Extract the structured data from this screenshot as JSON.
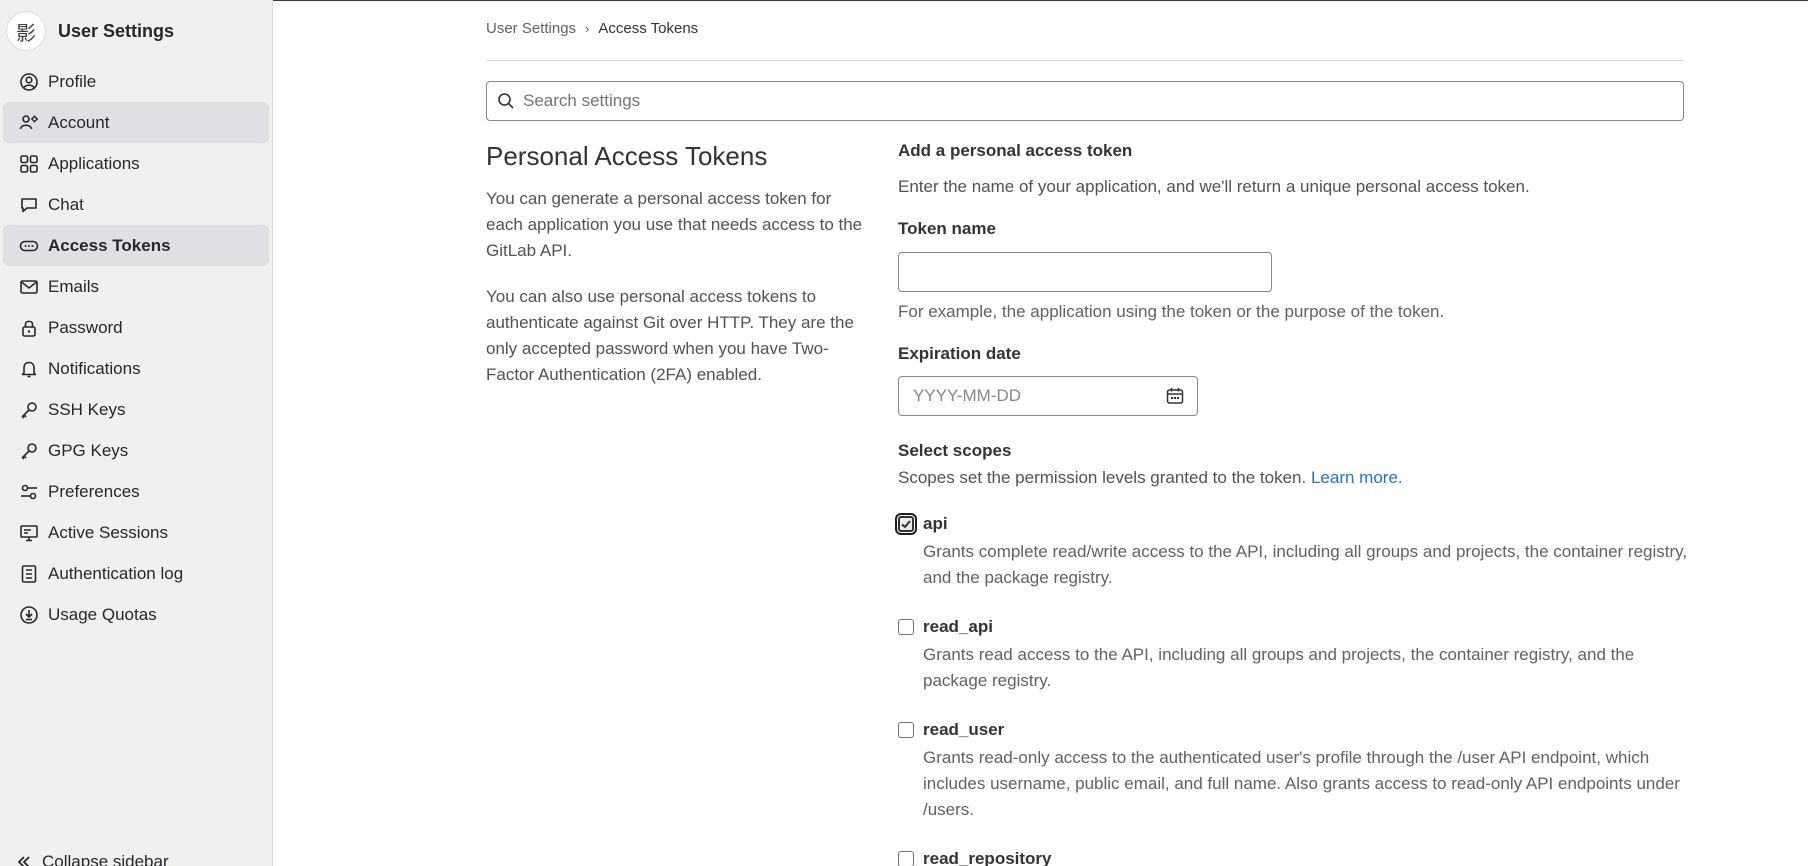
{
  "sidebar": {
    "avatar_glyph": "影",
    "title": "User Settings",
    "items": [
      {
        "label": "Profile",
        "icon": "profile-icon",
        "active": false
      },
      {
        "label": "Account",
        "icon": "account-icon",
        "active": true
      },
      {
        "label": "Applications",
        "icon": "applications-icon",
        "active": false
      },
      {
        "label": "Chat",
        "icon": "chat-icon",
        "active": false
      },
      {
        "label": "Access Tokens",
        "icon": "token-icon",
        "active": true
      },
      {
        "label": "Emails",
        "icon": "mail-icon",
        "active": false
      },
      {
        "label": "Password",
        "icon": "lock-icon",
        "active": false
      },
      {
        "label": "Notifications",
        "icon": "bell-icon",
        "active": false
      },
      {
        "label": "SSH Keys",
        "icon": "key-icon",
        "active": false
      },
      {
        "label": "GPG Keys",
        "icon": "key-icon",
        "active": false
      },
      {
        "label": "Preferences",
        "icon": "preferences-icon",
        "active": false
      },
      {
        "label": "Active Sessions",
        "icon": "monitor-icon",
        "active": false
      },
      {
        "label": "Authentication log",
        "icon": "log-icon",
        "active": false
      },
      {
        "label": "Usage Quotas",
        "icon": "quota-icon",
        "active": false
      }
    ],
    "collapse_label": "Collapse sidebar"
  },
  "breadcrumb": {
    "parent": "User Settings",
    "current": "Access Tokens"
  },
  "search": {
    "placeholder": "Search settings"
  },
  "intro": {
    "title": "Personal Access Tokens",
    "p1": "You can generate a personal access token for each application you use that needs access to the GitLab API.",
    "p2": "You can also use personal access tokens to authenticate against Git over HTTP. They are the only accepted password when you have Two-Factor Authentication (2FA) enabled."
  },
  "form": {
    "heading": "Add a personal access token",
    "description": "Enter the name of your application, and we'll return a unique personal access token.",
    "token_name_label": "Token name",
    "token_name_value": "",
    "token_name_help": "For example, the application using the token or the purpose of the token.",
    "expiration_label": "Expiration date",
    "expiration_placeholder": "YYYY-MM-DD",
    "scopes_label": "Select scopes",
    "scopes_desc": "Scopes set the permission levels granted to the token.",
    "learn_more": "Learn more.",
    "scopes": [
      {
        "name": "api",
        "checked": true,
        "text": "Grants complete read/write access to the API, including all groups and projects, the container registry, and the package registry."
      },
      {
        "name": "read_api",
        "checked": false,
        "text": "Grants read access to the API, including all groups and projects, the container registry, and the package registry."
      },
      {
        "name": "read_user",
        "checked": false,
        "text": "Grants read-only access to the authenticated user's profile through the /user API endpoint, which includes username, public email, and full name. Also grants access to read-only API endpoints under /users."
      },
      {
        "name": "read_repository",
        "checked": false,
        "text": ""
      }
    ]
  },
  "colors": {
    "sidebar_bg": "#f0f0f0",
    "active_item_bg": "#dfdfe4",
    "link": "#1f75cb"
  }
}
